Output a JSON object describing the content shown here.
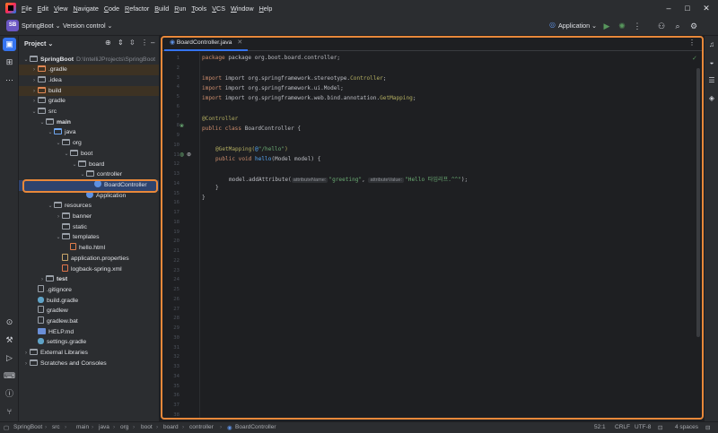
{
  "menubar": {
    "items": [
      "File",
      "Edit",
      "View",
      "Navigate",
      "Code",
      "Refactor",
      "Build",
      "Run",
      "Tools",
      "VCS",
      "Window",
      "Help"
    ]
  },
  "toolbar": {
    "project_badge": "SB",
    "project_name": "SpringBoot",
    "version_control": "Version control",
    "run_config": "Application"
  },
  "project_panel": {
    "title": "Project",
    "root_path": "D:\\IntelliJProjects\\SpringBoot",
    "tree": [
      {
        "label": "SpringBoot",
        "indent": 1,
        "chev": "v",
        "icon": "folder",
        "bold": true,
        "note": true
      },
      {
        "label": ".gradle",
        "indent": 2,
        "chev": ">",
        "icon": "folder-orange",
        "excluded": true
      },
      {
        "label": ".idea",
        "indent": 2,
        "chev": ">",
        "icon": "folder"
      },
      {
        "label": "build",
        "indent": 2,
        "chev": ">",
        "icon": "folder-orange",
        "excluded": true
      },
      {
        "label": "gradle",
        "indent": 2,
        "chev": ">",
        "icon": "folder"
      },
      {
        "label": "src",
        "indent": 2,
        "chev": "v",
        "icon": "folder"
      },
      {
        "label": "main",
        "indent": 3,
        "chev": "v",
        "icon": "folder",
        "bold": true
      },
      {
        "label": "java",
        "indent": 4,
        "chev": "v",
        "icon": "folder-blue"
      },
      {
        "label": "org",
        "indent": 5,
        "chev": "v",
        "icon": "folder"
      },
      {
        "label": "boot",
        "indent": 6,
        "chev": "v",
        "icon": "folder"
      },
      {
        "label": "board",
        "indent": 7,
        "chev": "v",
        "icon": "folder"
      },
      {
        "label": "controller",
        "indent": 8,
        "chev": "v",
        "icon": "folder"
      },
      {
        "label": "BoardController",
        "indent": 9,
        "chev": "",
        "icon": "klass",
        "selected": true
      },
      {
        "label": "Application",
        "indent": 8,
        "chev": "",
        "icon": "klass"
      },
      {
        "label": "resources",
        "indent": 4,
        "chev": "v",
        "icon": "folder"
      },
      {
        "label": "banner",
        "indent": 5,
        "chev": ">",
        "icon": "folder"
      },
      {
        "label": "static",
        "indent": 5,
        "chev": "",
        "icon": "folder"
      },
      {
        "label": "templates",
        "indent": 5,
        "chev": "v",
        "icon": "folder"
      },
      {
        "label": "hello.html",
        "indent": 6,
        "chev": "",
        "icon": "html"
      },
      {
        "label": "application.properties",
        "indent": 5,
        "chev": "",
        "icon": "props"
      },
      {
        "label": "logback-spring.xml",
        "indent": 5,
        "chev": "",
        "icon": "xml"
      },
      {
        "label": "test",
        "indent": 3,
        "chev": ">",
        "icon": "folder",
        "bold": true
      },
      {
        "label": ".gitignore",
        "indent": 2,
        "chev": "",
        "icon": "file"
      },
      {
        "label": "build.gradle",
        "indent": 2,
        "chev": "",
        "icon": "gradle"
      },
      {
        "label": "gradlew",
        "indent": 2,
        "chev": "",
        "icon": "file"
      },
      {
        "label": "gradlew.bat",
        "indent": 2,
        "chev": "",
        "icon": "file"
      },
      {
        "label": "HELP.md",
        "indent": 2,
        "chev": "",
        "icon": "md"
      },
      {
        "label": "settings.gradle",
        "indent": 2,
        "chev": "",
        "icon": "gradle"
      },
      {
        "label": "External Libraries",
        "indent": 1,
        "chev": ">",
        "icon": "folder"
      },
      {
        "label": "Scratches and Consoles",
        "indent": 1,
        "chev": ">",
        "icon": "folder"
      }
    ]
  },
  "editor": {
    "tab_label": "BoardController.java",
    "line_count": 38,
    "lines": {
      "l1": "package org.boot.board.controller;",
      "l3a": "import org.springframework.stereotype.",
      "l3b": "Controller",
      "l3c": ";",
      "l4": "import org.springframework.ui.Model;",
      "l5a": "import org.springframework.web.bind.annotation.",
      "l5b": "GetMapping",
      "l5c": ";",
      "l7": "@Controller",
      "l8a": "public class ",
      "l8b": "BoardController {",
      "l10a": "@GetMapping(",
      "l10b": "@",
      "l10c": "\"/hello\"",
      "l10d": ")",
      "l11a": "public void ",
      "l11b": "hello",
      "l11c": "(Model model) {",
      "l13a": "model.addAttribute(",
      "l13hint1": "attributeName:",
      "l13b": "\"greeting\"",
      "l13c": ", ",
      "l13hint2": "attributeValue:",
      "l13d": "\"Hello 타임리프.^^\"",
      "l13e": ");",
      "l14": "}",
      "l15": "}"
    }
  },
  "statusbar": {
    "crumbs": [
      "SpringBoot",
      "src",
      "main",
      "java",
      "org",
      "boot",
      "board",
      "controller",
      "BoardController"
    ],
    "position": "52:1",
    "line_sep": "CRLF",
    "encoding": "UTF-8",
    "indent": "4 spaces"
  },
  "colors": {
    "accent": "#3574f0",
    "highlight_box": "#e8883a"
  }
}
